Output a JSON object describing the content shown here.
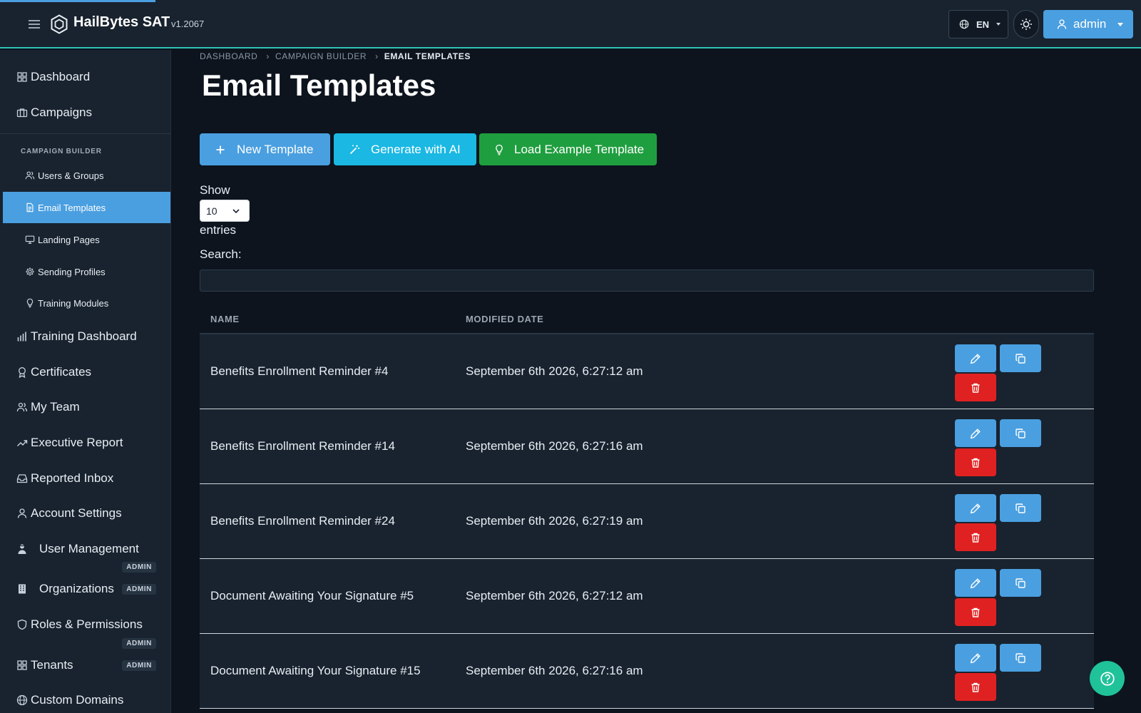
{
  "header": {
    "brand": "HailBytes SAT",
    "version": "v1.2067",
    "language": "EN",
    "user_label": "admin"
  },
  "sidebar": {
    "top_items": [
      {
        "label": "Dashboard",
        "icon": "grid-icon"
      },
      {
        "label": "Campaigns",
        "icon": "briefcase-icon"
      }
    ],
    "section_label": "CAMPAIGN BUILDER",
    "sub_items": [
      {
        "label": "Users & Groups",
        "icon": "users-icon"
      },
      {
        "label": "Email Templates",
        "icon": "document-icon",
        "active": true
      },
      {
        "label": "Landing Pages",
        "icon": "monitor-icon"
      },
      {
        "label": "Sending Profiles",
        "icon": "gear-icon"
      },
      {
        "label": "Training Modules",
        "icon": "lightbulb-icon"
      }
    ],
    "bottom_items": [
      {
        "label": "Training Dashboard",
        "icon": "bar-chart-icon"
      },
      {
        "label": "Certificates",
        "icon": "award-icon"
      },
      {
        "label": "My Team",
        "icon": "team-icon"
      },
      {
        "label": "Executive Report",
        "icon": "trending-up-icon"
      },
      {
        "label": "Reported Inbox",
        "icon": "inbox-icon"
      },
      {
        "label": "Account Settings",
        "icon": "user-icon"
      },
      {
        "label": "User Management",
        "icon": "user-shield-icon",
        "badge": "ADMIN"
      },
      {
        "label": "Organizations",
        "icon": "building-icon",
        "badge": "ADMIN"
      },
      {
        "label": "Roles & Permissions",
        "icon": "shield-icon",
        "badge": "ADMIN"
      },
      {
        "label": "Tenants",
        "icon": "grid-icon",
        "badge": "ADMIN"
      },
      {
        "label": "Custom Domains",
        "icon": "globe-icon"
      }
    ]
  },
  "breadcrumb": {
    "items": [
      "DASHBOARD",
      "CAMPAIGN BUILDER"
    ],
    "current": "EMAIL TEMPLATES"
  },
  "main": {
    "title": "Email Templates",
    "actions": {
      "new_template": "New Template",
      "generate_ai": "Generate with AI",
      "load_example": "Load Example Template"
    },
    "show_label": "Show",
    "entries_value": "10",
    "entries_label": "entries",
    "search_label": "Search:",
    "search_value": ""
  },
  "table": {
    "columns": [
      "NAME",
      "MODIFIED DATE"
    ],
    "rows": [
      {
        "name": "Benefits Enrollment Reminder #4",
        "modified": "September 6th 2026, 6:27:12 am"
      },
      {
        "name": "Benefits Enrollment Reminder #14",
        "modified": "September 6th 2026, 6:27:16 am"
      },
      {
        "name": "Benefits Enrollment Reminder #24",
        "modified": "September 6th 2026, 6:27:19 am"
      },
      {
        "name": "Document Awaiting Your Signature #5",
        "modified": "September 6th 2026, 6:27:12 am"
      },
      {
        "name": "Document Awaiting Your Signature #15",
        "modified": "September 6th 2026, 6:27:16 am"
      }
    ]
  },
  "colors": {
    "primary": "#4a9fe0",
    "info": "#1ab8e3",
    "success": "#1f9e3f",
    "danger": "#e02121",
    "help": "#20c29a",
    "accent_line": "#2fc3b7"
  }
}
